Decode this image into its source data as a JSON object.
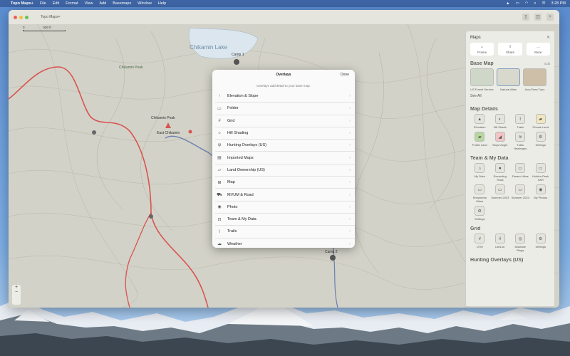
{
  "menubar": {
    "app_name": "Topo Maps+",
    "items": [
      "File",
      "Edit",
      "Format",
      "View",
      "Add",
      "Basemaps",
      "Window",
      "Help"
    ],
    "clock": "3:28 PM"
  },
  "window": {
    "title": "Topo Maps+",
    "scale_labels": [
      "0",
      "500 ft"
    ]
  },
  "map": {
    "labels": {
      "lake": "Chikamin Lake",
      "peak1": "Chikamin Peak",
      "peak2": "Chikamin Peak",
      "place": "East Chikamin",
      "camp1": "Camp 1",
      "camp2": "Camp 2"
    },
    "route_color": "#d9534f"
  },
  "overlays_dialog": {
    "title": "Overlays",
    "done": "Done",
    "subtitle": "Overlays add detail to your base map.",
    "items": [
      {
        "label": "Elevation & Slope",
        "icon": "↑"
      },
      {
        "label": "Folder",
        "icon": "▭"
      },
      {
        "label": "Grid",
        "icon": "#"
      },
      {
        "label": "Hill Shading",
        "icon": "☼"
      },
      {
        "label": "Hunting Overlays (US)",
        "icon": "ψ"
      },
      {
        "label": "Imported Maps",
        "icon": "▤"
      },
      {
        "label": "Land Ownership (US)",
        "icon": "▱"
      },
      {
        "label": "Map",
        "icon": "⊞"
      },
      {
        "label": "MVUM & Road",
        "icon": "⛟"
      },
      {
        "label": "Photo",
        "icon": "◉"
      },
      {
        "label": "Team & My Data",
        "icon": "⊡"
      },
      {
        "label": "Trails",
        "icon": "⌇"
      },
      {
        "label": "Weather",
        "icon": "☁"
      }
    ]
  },
  "panel": {
    "title": "Maps",
    "actions": [
      {
        "label": "Frame",
        "icon": "⌂"
      },
      {
        "label": "Share",
        "icon": "⇪"
      },
      {
        "label": "More",
        "icon": "…"
      }
    ],
    "base_map": {
      "title": "Base Map",
      "edit": "Edit",
      "tiles": [
        {
          "label": "US Forest Service",
          "selected": false
        },
        {
          "label": "Natural Atlas",
          "selected": true
        },
        {
          "label": "AccuTerra Topo",
          "selected": false
        }
      ],
      "see_all": "See All"
    },
    "map_details": {
      "title": "Map Details",
      "tiles": [
        {
          "label": "Elevation",
          "icon": "▲"
        },
        {
          "label": "Hill Shade",
          "icon": "◐"
        },
        {
          "label": "Trails",
          "icon": "⌇"
        },
        {
          "label": "Private Land",
          "icon": "▰"
        },
        {
          "label": "Public Land",
          "icon": "▰"
        },
        {
          "label": "Slope Angle",
          "icon": "◢"
        },
        {
          "label": "Trails Heatmaps",
          "icon": "≋"
        },
        {
          "label": "Settings",
          "icon": "⚙"
        }
      ]
    },
    "team_data": {
      "title": "Team & My Data",
      "tiles": [
        {
          "label": "My Data",
          "icon": "⌂"
        },
        {
          "label": "Recording Track",
          "icon": "⏺"
        },
        {
          "label": "Dream Hikes",
          "icon": "▭"
        },
        {
          "label": "Hidden Peak SAR",
          "icon": "▭"
        },
        {
          "label": "Shepherds Hikes",
          "icon": "▭"
        },
        {
          "label": "Summer 2023",
          "icon": "▭"
        },
        {
          "label": "Summer 2024",
          "icon": "▭"
        },
        {
          "label": "My Photos",
          "icon": "◉"
        },
        {
          "label": "Settings",
          "icon": "⚙"
        }
      ]
    },
    "grid": {
      "title": "Grid",
      "tiles": [
        {
          "label": "UTM",
          "icon": "#"
        },
        {
          "label": "Lat/Lon",
          "icon": "#"
        },
        {
          "label": "Distance Rings",
          "icon": "◎"
        },
        {
          "label": "Settings",
          "icon": "⚙"
        }
      ]
    },
    "bottom_section": "Hunting Overlays (US)"
  }
}
